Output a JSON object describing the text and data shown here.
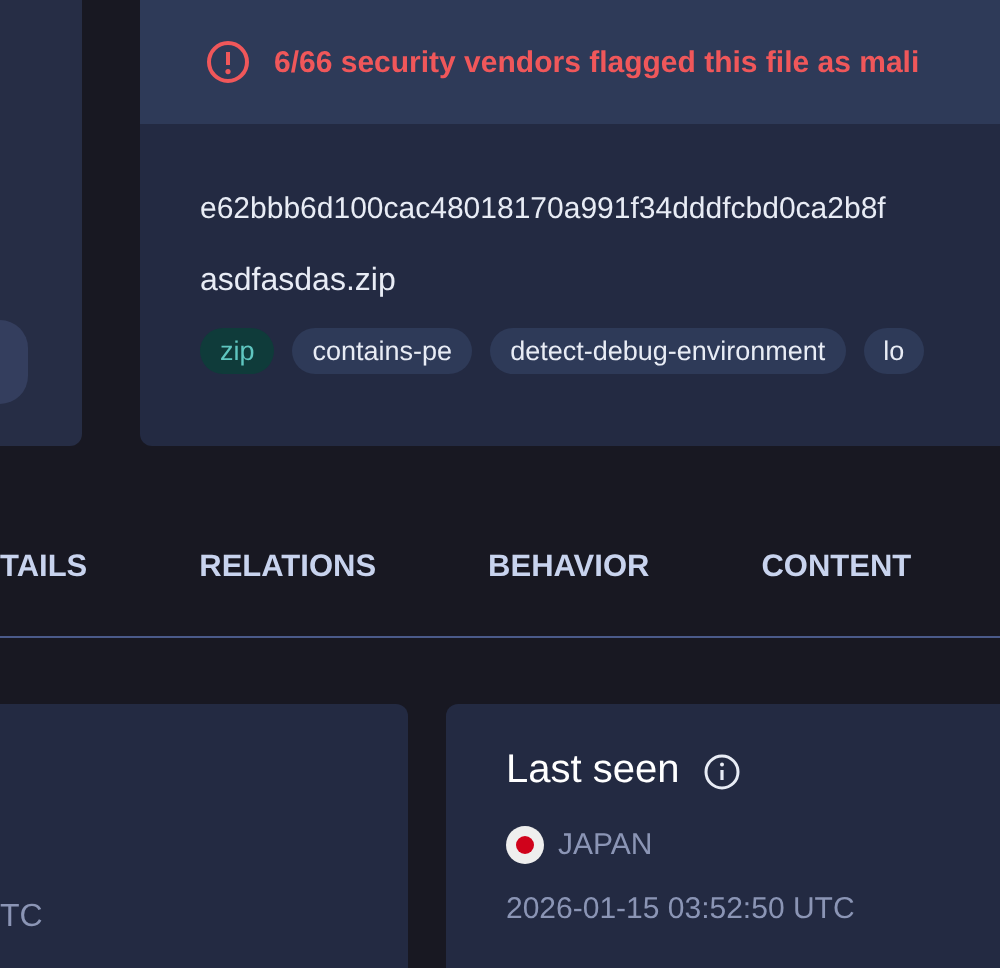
{
  "alert": {
    "text": "6/66 security vendors flagged this file as mali"
  },
  "file": {
    "hash": "e62bbb6d100cac48018170a991f34dddfcbd0ca2b8f",
    "name": "asdfasdas.zip"
  },
  "tags": [
    {
      "label": "zip",
      "kind": "filetype"
    },
    {
      "label": "contains-pe",
      "kind": "plain"
    },
    {
      "label": "detect-debug-environment",
      "kind": "plain"
    },
    {
      "label": "lo",
      "kind": "plain"
    }
  ],
  "tabs": [
    {
      "label": "TAILS",
      "selected": false
    },
    {
      "label": "RELATIONS",
      "selected": false
    },
    {
      "label": "BEHAVIOR",
      "selected": false
    },
    {
      "label": "CONTENT",
      "selected": false
    }
  ],
  "first_card": {
    "date_tail": "TC"
  },
  "last_seen": {
    "title": "Last seen",
    "country": "JAPAN",
    "date": "2026-01-15 03:52:50 UTC"
  }
}
